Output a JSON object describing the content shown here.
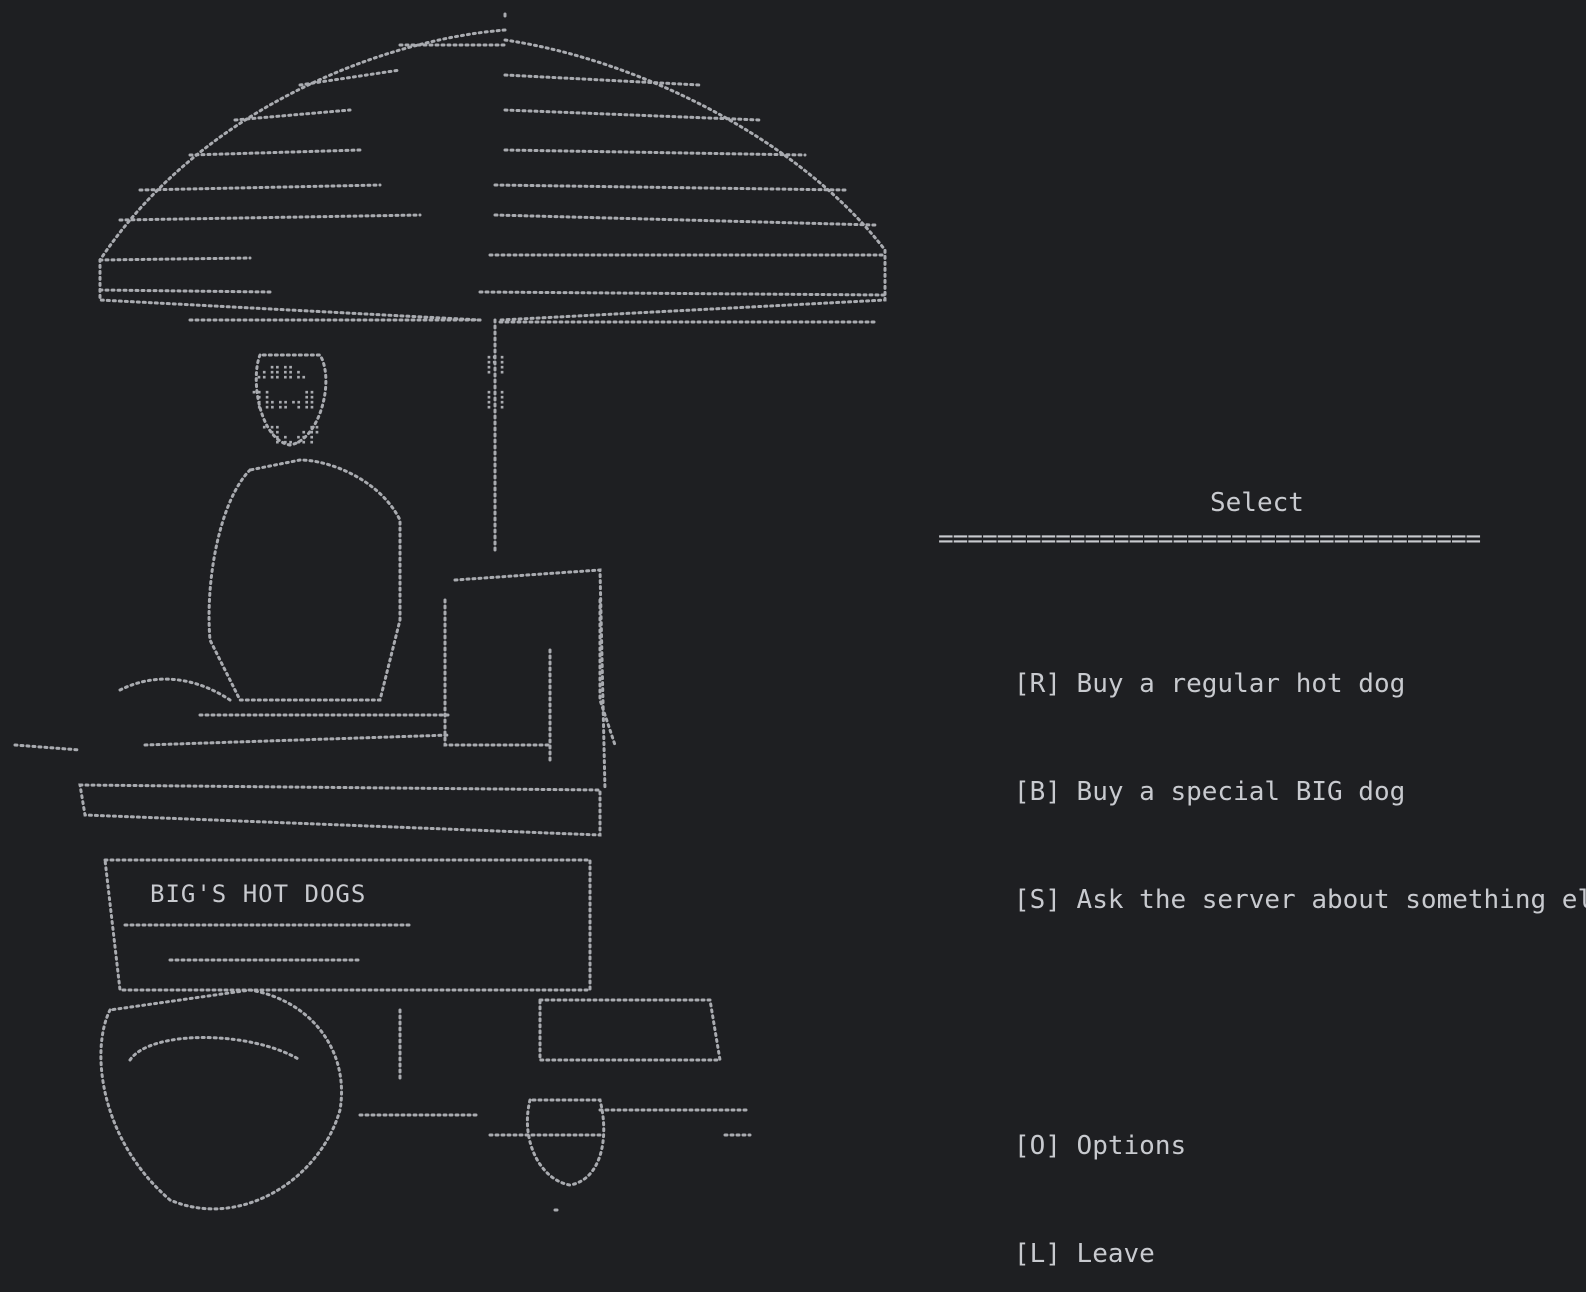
{
  "colors": {
    "background": "#1e1f22",
    "foreground": "#c8cacf",
    "art": "#a9abb0"
  },
  "art": {
    "sign_text": "BIG'S HOT DOGS"
  },
  "menu": {
    "title": "Select",
    "rule": "=====================================",
    "items": [
      {
        "key": "[R]",
        "label": "Buy a regular hot dog"
      },
      {
        "key": "[B]",
        "label": "Buy a special BIG dog"
      },
      {
        "key": "[S]",
        "label": "Ask the server about something else"
      }
    ],
    "secondary_items": [
      {
        "key": "[O]",
        "label": "Options"
      },
      {
        "key": "[L]",
        "label": "Leave"
      }
    ]
  }
}
